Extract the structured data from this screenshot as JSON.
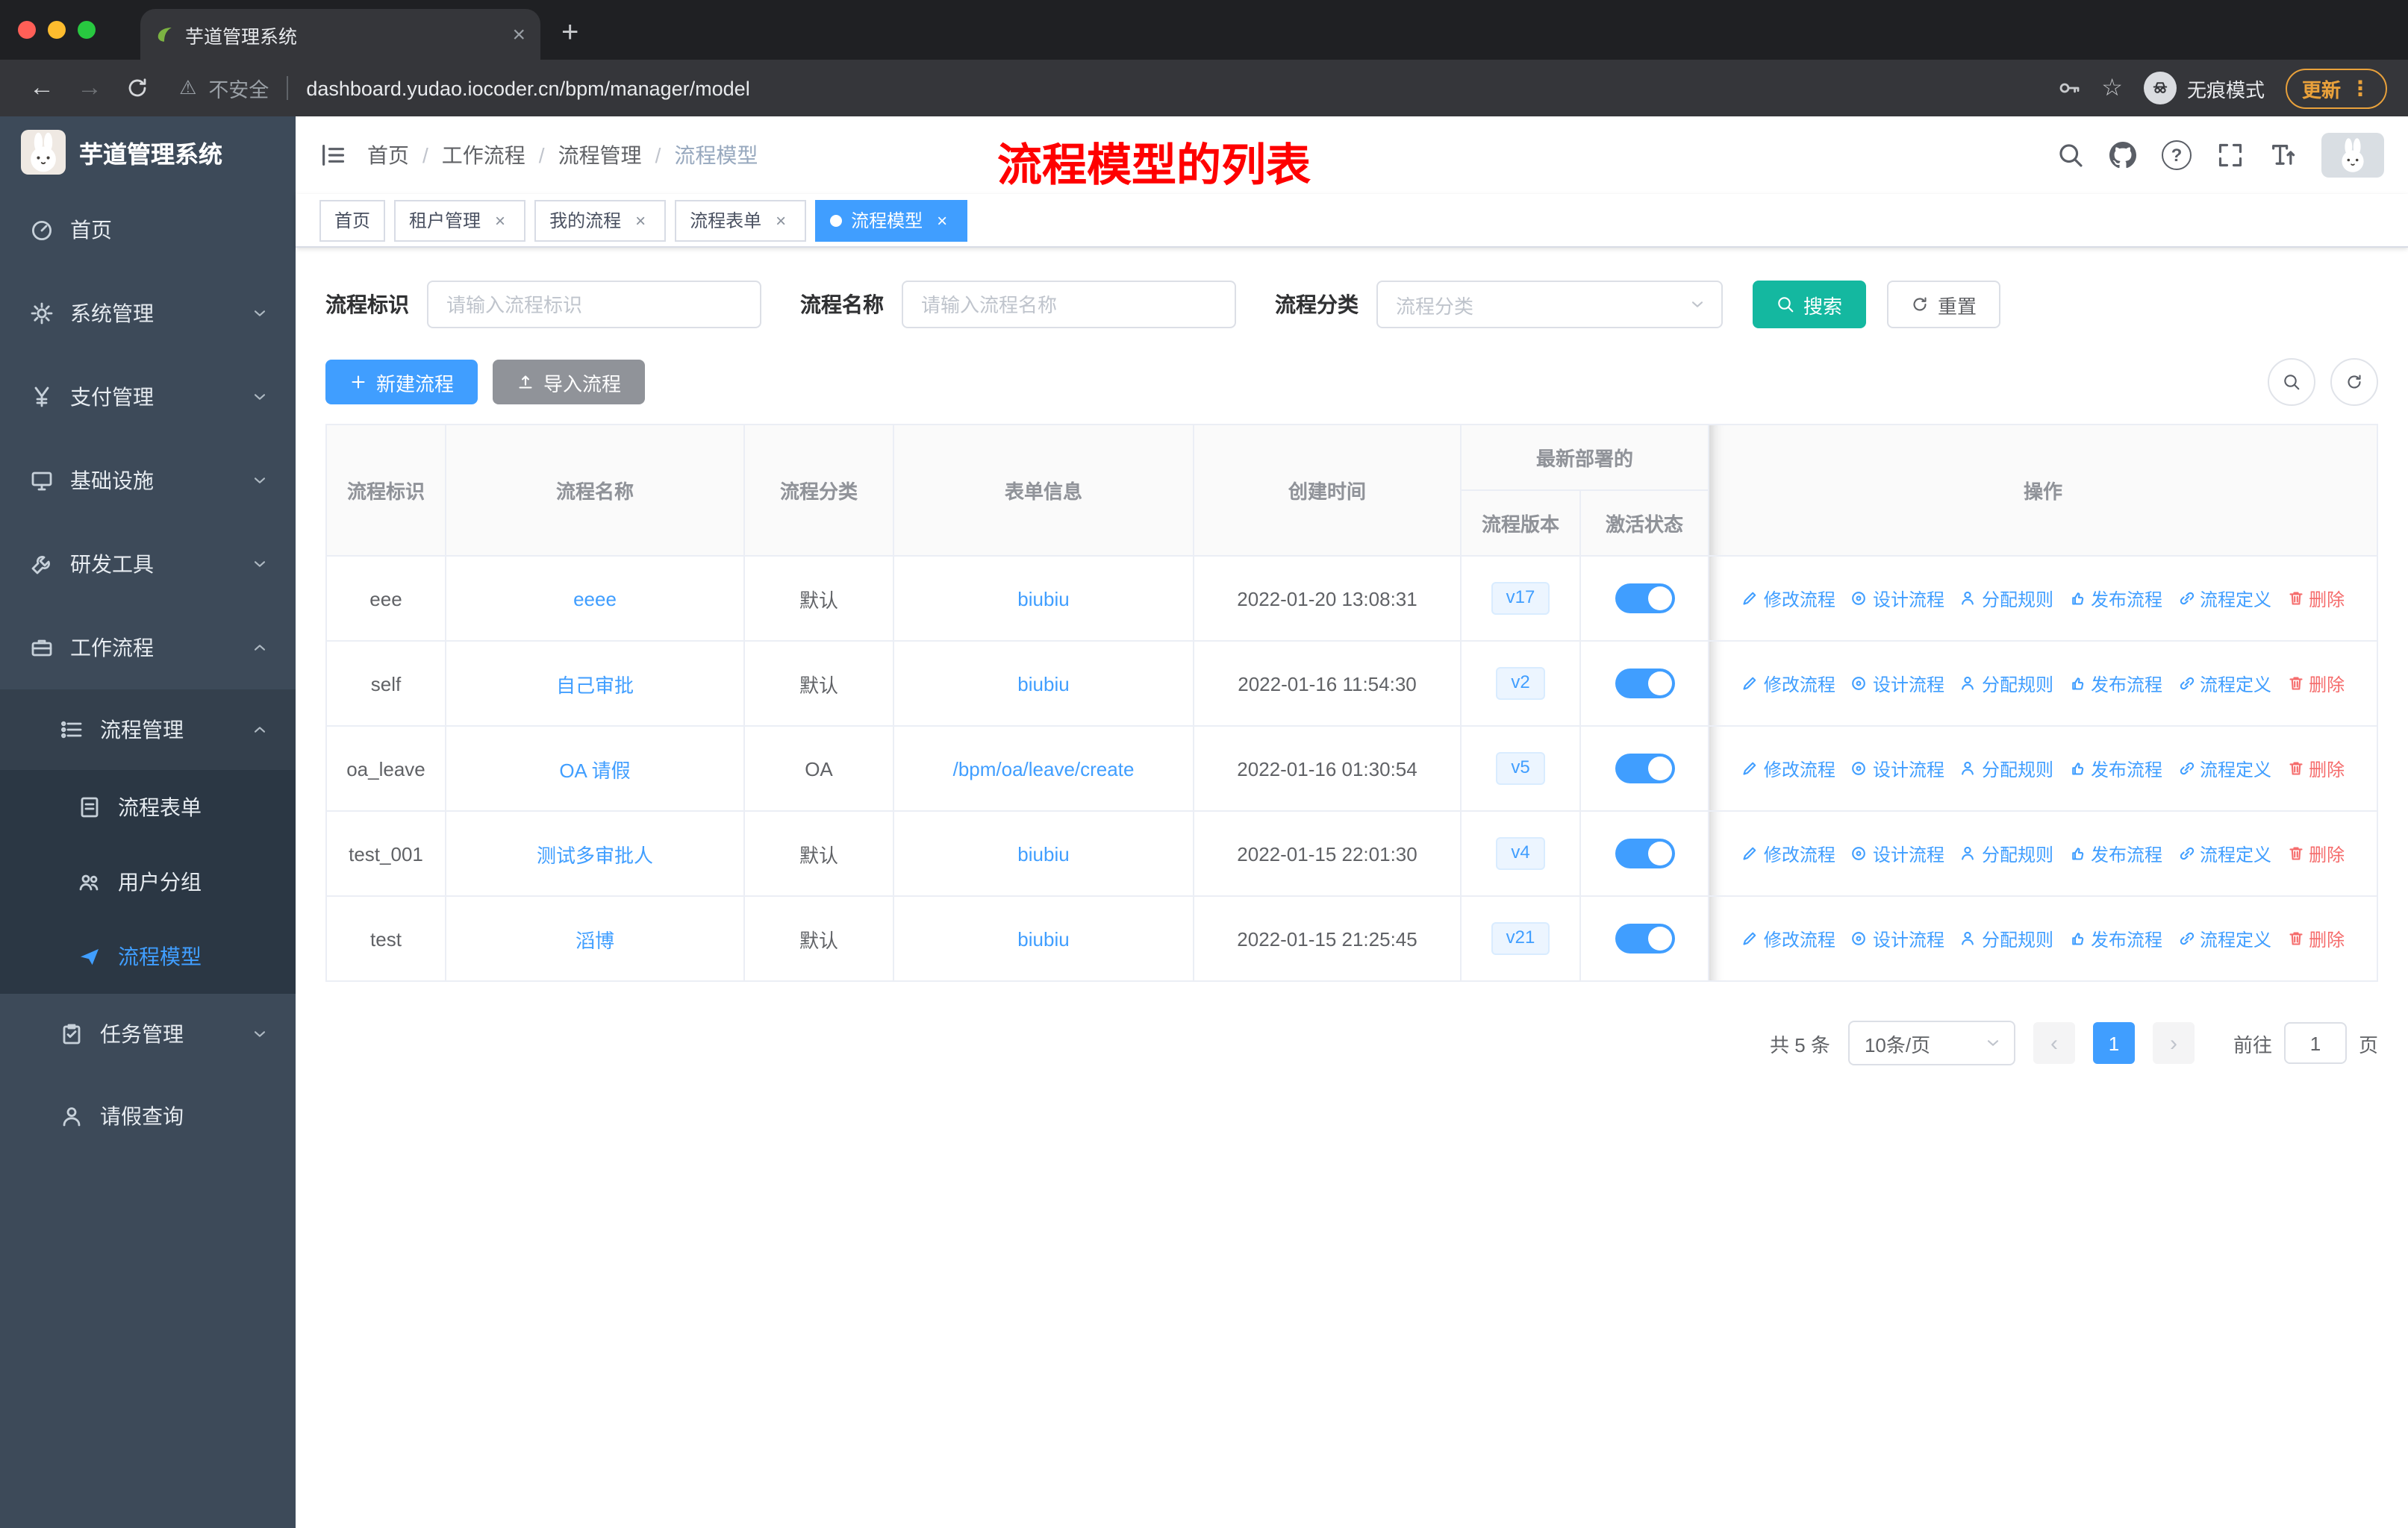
{
  "colors": {
    "accent": "#409EFF",
    "search_button": "#14b8a0",
    "danger": "#f56c6c",
    "annotation_red": "#ff0000",
    "sidebar_bg": "#3d4a59",
    "chrome_update": "#e9a13b"
  },
  "glyphs": {
    "close": "×",
    "plus": "+",
    "star": "☆",
    "warning": "⚠",
    "kebab": "⋮",
    "back": "←",
    "forward": "→",
    "prev": "‹",
    "next": "›"
  },
  "browser": {
    "tab_title": "芋道管理系统",
    "security_label": "不安全",
    "url": "dashboard.yudao.iocoder.cn/bpm/manager/model",
    "incognito_label": "无痕模式",
    "update_label": "更新"
  },
  "sidebar": {
    "logo_title": "芋道管理系统",
    "items": [
      {
        "label": "首页"
      },
      {
        "label": "系统管理"
      },
      {
        "label": "支付管理"
      },
      {
        "label": "基础设施"
      },
      {
        "label": "研发工具"
      },
      {
        "label": "工作流程"
      },
      {
        "label": "流程管理"
      },
      {
        "label": "流程表单"
      },
      {
        "label": "用户分组"
      },
      {
        "label": "流程模型",
        "active": true
      },
      {
        "label": "任务管理"
      },
      {
        "label": "请假查询"
      }
    ]
  },
  "header": {
    "breadcrumb": [
      "首页",
      "工作流程",
      "流程管理",
      "流程模型"
    ],
    "annotation": "流程模型的列表"
  },
  "tags": [
    {
      "label": "首页"
    },
    {
      "label": "租户管理"
    },
    {
      "label": "我的流程"
    },
    {
      "label": "流程表单"
    },
    {
      "label": "流程模型"
    }
  ],
  "filters": {
    "id_label": "流程标识",
    "id_placeholder": "请输入流程标识",
    "name_label": "流程名称",
    "name_placeholder": "请输入流程名称",
    "category_label": "流程分类",
    "category_placeholder": "流程分类",
    "search_label": "搜索",
    "reset_label": "重置"
  },
  "toolbar": {
    "create_label": "新建流程",
    "import_label": "导入流程"
  },
  "table": {
    "headers": {
      "id": "流程标识",
      "name": "流程名称",
      "category": "流程分类",
      "form": "表单信息",
      "created": "创建时间",
      "deployed_group": "最新部署的",
      "version": "流程版本",
      "active": "激活状态",
      "actions": "操作"
    },
    "action_labels": [
      "修改流程",
      "设计流程",
      "分配规则",
      "发布流程",
      "流程定义",
      "删除"
    ],
    "rows": [
      {
        "id": "eee",
        "name": "eeee",
        "category": "默认",
        "form": "biubiu",
        "created": "2022-01-20 13:08:31",
        "version": "v17",
        "active": true
      },
      {
        "id": "self",
        "name": "自己审批",
        "category": "默认",
        "form": "biubiu",
        "created": "2022-01-16 11:54:30",
        "version": "v2",
        "active": true
      },
      {
        "id": "oa_leave",
        "name": "OA 请假",
        "category": "OA",
        "form": "/bpm/oa/leave/create",
        "created": "2022-01-16 01:30:54",
        "version": "v5",
        "active": true
      },
      {
        "id": "test_001",
        "name": "测试多审批人",
        "category": "默认",
        "form": "biubiu",
        "created": "2022-01-15 22:01:30",
        "version": "v4",
        "active": true
      },
      {
        "id": "test",
        "name": "滔博",
        "category": "默认",
        "form": "biubiu",
        "created": "2022-01-15 21:25:45",
        "version": "v21",
        "active": true
      }
    ]
  },
  "pagination": {
    "total": "共 5 条",
    "page_size": "10条/页",
    "current_page": "1",
    "goto_label": "前往",
    "page_unit": "页",
    "goto_value": "1"
  }
}
